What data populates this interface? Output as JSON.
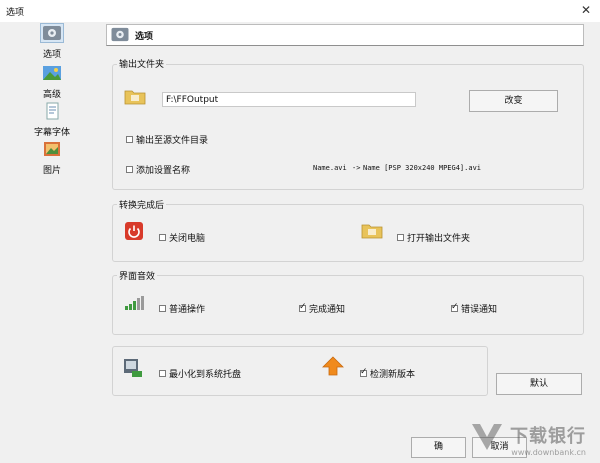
{
  "window": {
    "title": "选项",
    "close_glyph": "✕"
  },
  "sidebar": {
    "items": [
      {
        "label": "选项",
        "icon": "settings-icon",
        "selected": true
      },
      {
        "label": "高级",
        "icon": "image-icon",
        "selected": false
      },
      {
        "label": "字幕字体",
        "icon": "document-icon",
        "selected": false
      },
      {
        "label": "图片",
        "icon": "picture-icon",
        "selected": false
      }
    ]
  },
  "header": {
    "title": "选项"
  },
  "output_folder": {
    "group_label": "输出文件夹",
    "path_value": "F:\\FFOutput",
    "change_button": "改变",
    "output_to_source": {
      "label": "输出至源文件目录",
      "checked": false
    },
    "add_setting_name": {
      "label": "添加设置名称",
      "checked": false
    },
    "example_source": "Name.avi",
    "example_arrow": "->",
    "example_result": "Name [PSP 320x240 MPEG4].avi"
  },
  "after_convert": {
    "group_label": "转换完成后",
    "shutdown": {
      "label": "关闭电脑",
      "checked": false
    },
    "open_folder": {
      "label": "打开输出文件夹",
      "checked": false
    }
  },
  "ui_sound": {
    "group_label": "界面音效",
    "normal": {
      "label": "普通操作",
      "checked": false
    },
    "done": {
      "label": "完成通知",
      "checked": true
    },
    "error": {
      "label": "错误通知",
      "checked": true
    }
  },
  "misc": {
    "minimize_tray": {
      "label": "最小化到系统托盘",
      "checked": false
    },
    "check_update": {
      "label": "检测新版本",
      "checked": true
    }
  },
  "buttons": {
    "default": "默认",
    "ok": "确",
    "cancel": "取消"
  },
  "watermark": {
    "text": "下载银行",
    "url": "www.downbank.cn"
  },
  "colors": {
    "accent": "#d83a2a",
    "update_arrow": "#f08a1c",
    "folder": "#e8c35a"
  }
}
